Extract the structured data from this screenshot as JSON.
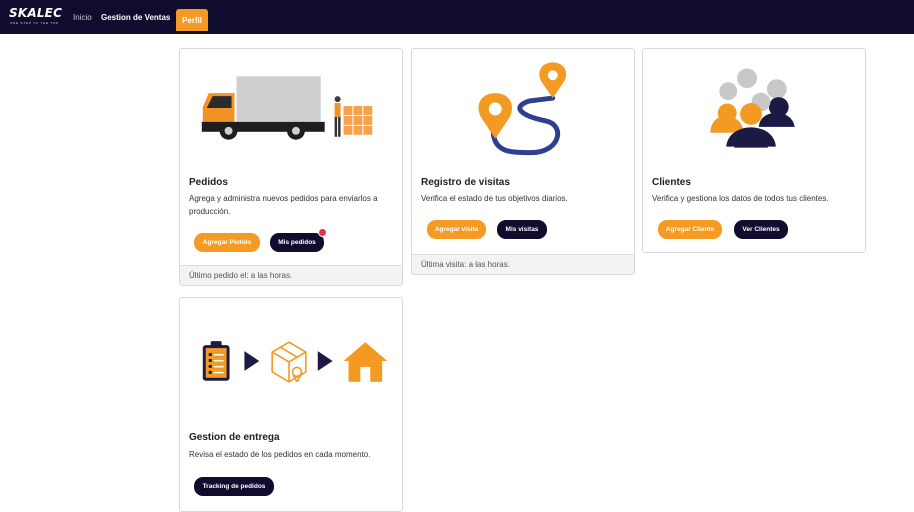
{
  "brand": {
    "name": "SKALEC",
    "tagline": "ONE STEP TO THE TOP"
  },
  "nav": {
    "inicio": "Inicio",
    "ventas": "Gestion de Ventas",
    "perfil": "Perfil"
  },
  "cards": {
    "pedidos": {
      "title": "Pedidos",
      "description": "Agrega y administra nuevos pedidos para enviarlos a producción.",
      "primary": "Agregar Pedido",
      "secondary": "Mis pedidos",
      "footer": "Último pedido el: a las horas."
    },
    "visitas": {
      "title": "Registro de visitas",
      "description": "Verifica el estado de tus objetivos diarios.",
      "primary": "Agregar visita",
      "secondary": "Mis visitas",
      "footer": "Última visita: a las horas."
    },
    "clientes": {
      "title": "Clientes",
      "description": "Verifica y gestiona los datos de todos tus clientes.",
      "primary": "Agregar Cliente",
      "secondary": "Ver Clientes"
    },
    "entrega": {
      "title": "Gestion de entrega",
      "description": "Revisa el estado de los pedidos en cada momento.",
      "primary": "Tracking de pedidos"
    }
  },
  "colors": {
    "navy": "#0f0c2e",
    "orange": "#f59a23",
    "badge": "#e0334d",
    "route": "#2f3f8f"
  },
  "icons": [
    "truck-icon",
    "route-pins-icon",
    "users-group-icon",
    "clipboard-icon",
    "package-icon",
    "house-icon",
    "chevron-right-icon"
  ]
}
